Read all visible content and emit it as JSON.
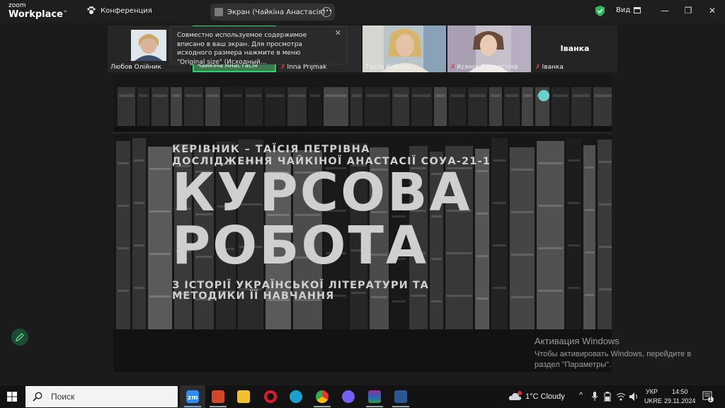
{
  "app": {
    "logo_line1": "zoom",
    "logo_line2": "Workplace",
    "meeting_label": "Конференция",
    "screen_label": "Экран (Чайкіна Анастасія)",
    "view_label": "Вид"
  },
  "participants": [
    {
      "name": "Любов Олійник",
      "muted": false,
      "has_video": true
    },
    {
      "name": "Чайкіна Анастасія",
      "muted": false,
      "has_video": true,
      "active": true
    },
    {
      "name": "Inna Prijmak",
      "muted": true,
      "has_video": true
    },
    {
      "name": "Таїсія Коваль",
      "muted": false,
      "has_video": true
    },
    {
      "name": "Ксенія Старостіна",
      "muted": true,
      "has_video": true
    },
    {
      "name": "Іванка",
      "muted": true,
      "has_video": false
    }
  ],
  "tooltip": {
    "text": "Совместно используемое содержимое вписано в ваш экран. Для просмотра исходного размера нажмите в меню \"Original size\" (Исходный..."
  },
  "slide": {
    "line1": "Керівник – Таїсія Петрівна",
    "line2": "дослідження Чайкіної Анастасії СОУА-21-1",
    "title1": "Курсова",
    "title2": "робота",
    "line3": "з історії української літератури та",
    "line4": "методики її навчання",
    "accent_color": "#4fd982"
  },
  "watermark": {
    "title": "Активация Windows",
    "body": "Чтобы активировать Windows, перейдите в раздел \"Параметры\"."
  },
  "taskbar": {
    "search_placeholder": "Поиск",
    "apps": [
      "zoom",
      "powerpoint-alt",
      "file-explorer",
      "opera",
      "edge",
      "chrome",
      "viber",
      "winrar",
      "word"
    ],
    "weather": "1°C  Cloudy",
    "language_top": "УКР",
    "language_bottom": "UKRE",
    "time": "14:50",
    "date": "29.11.2024",
    "notification_count": "1"
  }
}
